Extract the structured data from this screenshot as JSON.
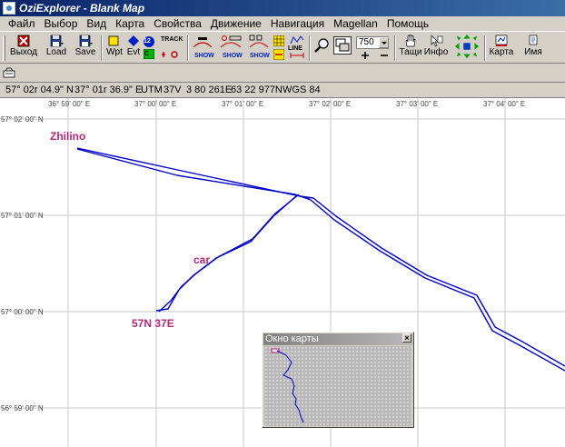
{
  "window": {
    "title": "OziExplorer - Blank Map"
  },
  "menu": [
    "Файл",
    "Выбор",
    "Вид",
    "Карта",
    "Свойства",
    "Движение",
    "Навигация",
    "Magellan",
    "Помощь"
  ],
  "toolbar": {
    "exit_label": "Выход",
    "load_label": "Load",
    "save_label": "Save",
    "wpt_label": "Wpt",
    "evt_label": "Evt",
    "track_label": "TRACK",
    "show_label": "SHOW",
    "line_label": "LINE",
    "num_12": "12",
    "num_c": "C",
    "zoom_value": "750",
    "drag_label": "Тащи",
    "info_label": "Инфо",
    "map_label": "Карта",
    "name_label": "Имя"
  },
  "status": {
    "latitude": "57° 02r 04.9\" N",
    "longitude": "37° 01r 36.9\" E",
    "utm": "UTM",
    "zone": "37V",
    "easting": "3 80 261E",
    "northing": "63 22 977N",
    "datum": "WGS 84"
  },
  "map": {
    "grid_labels_top": [
      "36° 59' 00\" E",
      "37° 00' 00\" E",
      "37° 01' 00\" E",
      "37° 02' 00\" E",
      "37° 03' 00\" E",
      "37° 04' 00\" E"
    ],
    "grid_labels_left": [
      "57° 02' 00\" N",
      "57° 01' 00\" N",
      "57° 00' 00\" N",
      "56° 59' 00\" N"
    ],
    "waypoints": {
      "zhilino": "Zhilino",
      "car": "car",
      "origin": "57N 37E"
    },
    "track_color": "#0000c8",
    "waypoint_color": "#b42878",
    "grid_color": "#c8c8c8"
  },
  "overview": {
    "title": "Окно карты",
    "close_label": "×"
  }
}
